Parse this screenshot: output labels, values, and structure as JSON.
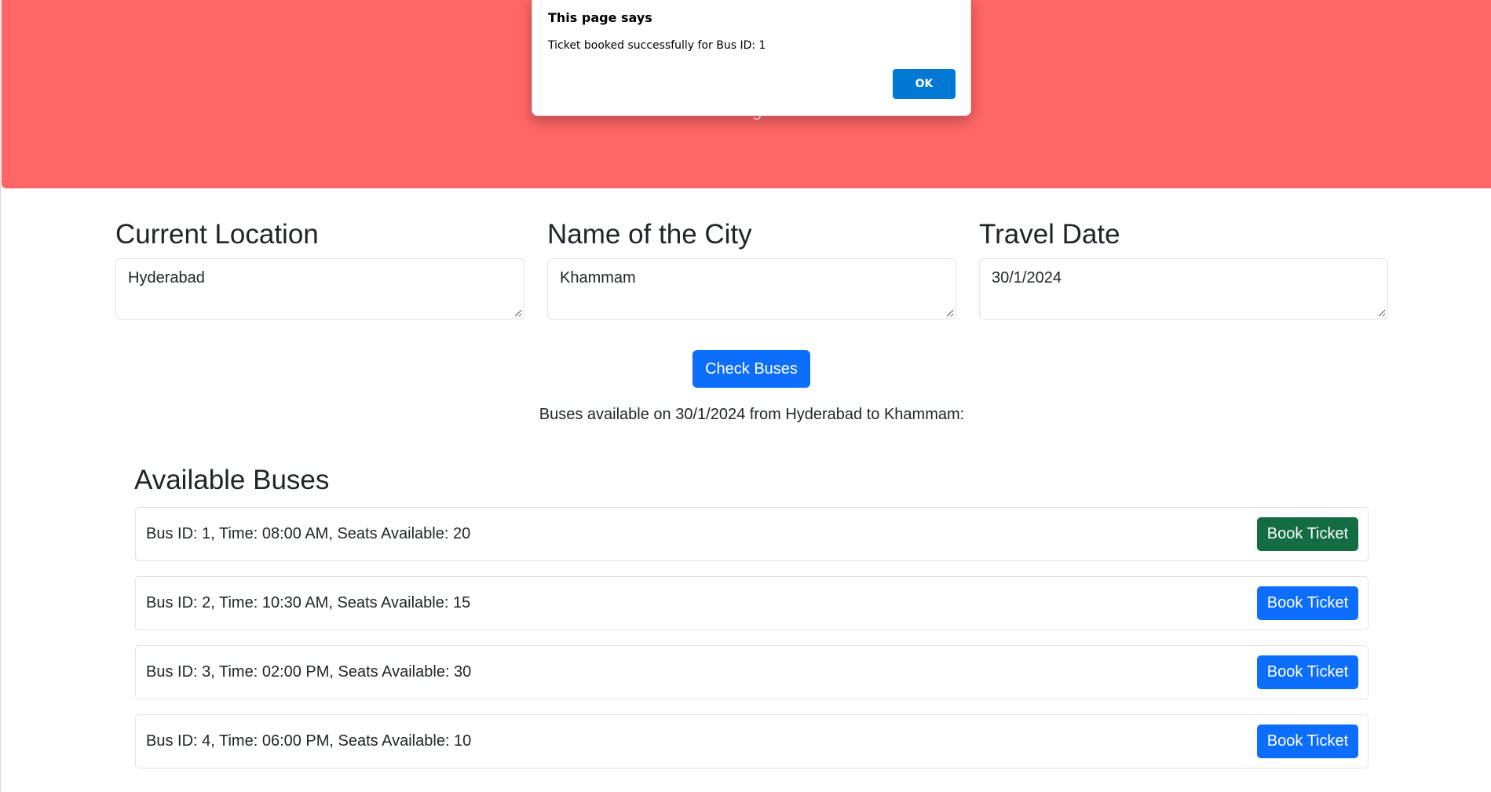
{
  "hero": {
    "subtitle": "Welcome to Telangana State Tour."
  },
  "form": {
    "current_location": {
      "label": "Current Location",
      "value": "Hyderabad"
    },
    "city": {
      "label": "Name of the City",
      "value": "Khammam"
    },
    "travel_date": {
      "label": "Travel Date",
      "value": "30/1/2024"
    },
    "check_button": "Check Buses"
  },
  "result_text": "Buses available on 30/1/2024 from Hyderabad to Khammam:",
  "buses": {
    "title": "Available Buses",
    "button_label": "Book Ticket",
    "items": [
      {
        "text": "Bus ID: 1, Time: 08:00 AM, Seats Available: 20"
      },
      {
        "text": "Bus ID: 2, Time: 10:30 AM, Seats Available: 15"
      },
      {
        "text": "Bus ID: 3, Time: 02:00 PM, Seats Available: 30"
      },
      {
        "text": "Bus ID: 4, Time: 06:00 PM, Seats Available: 10"
      }
    ]
  },
  "dialog": {
    "title": "This page says",
    "message": "Ticket booked successfully for Bus ID: 1",
    "ok_label": "OK"
  },
  "colors": {
    "hero": "#ff6666",
    "primary": "#0d6efd",
    "active_button": "#146c43",
    "dialog_ok": "#0078d4"
  }
}
